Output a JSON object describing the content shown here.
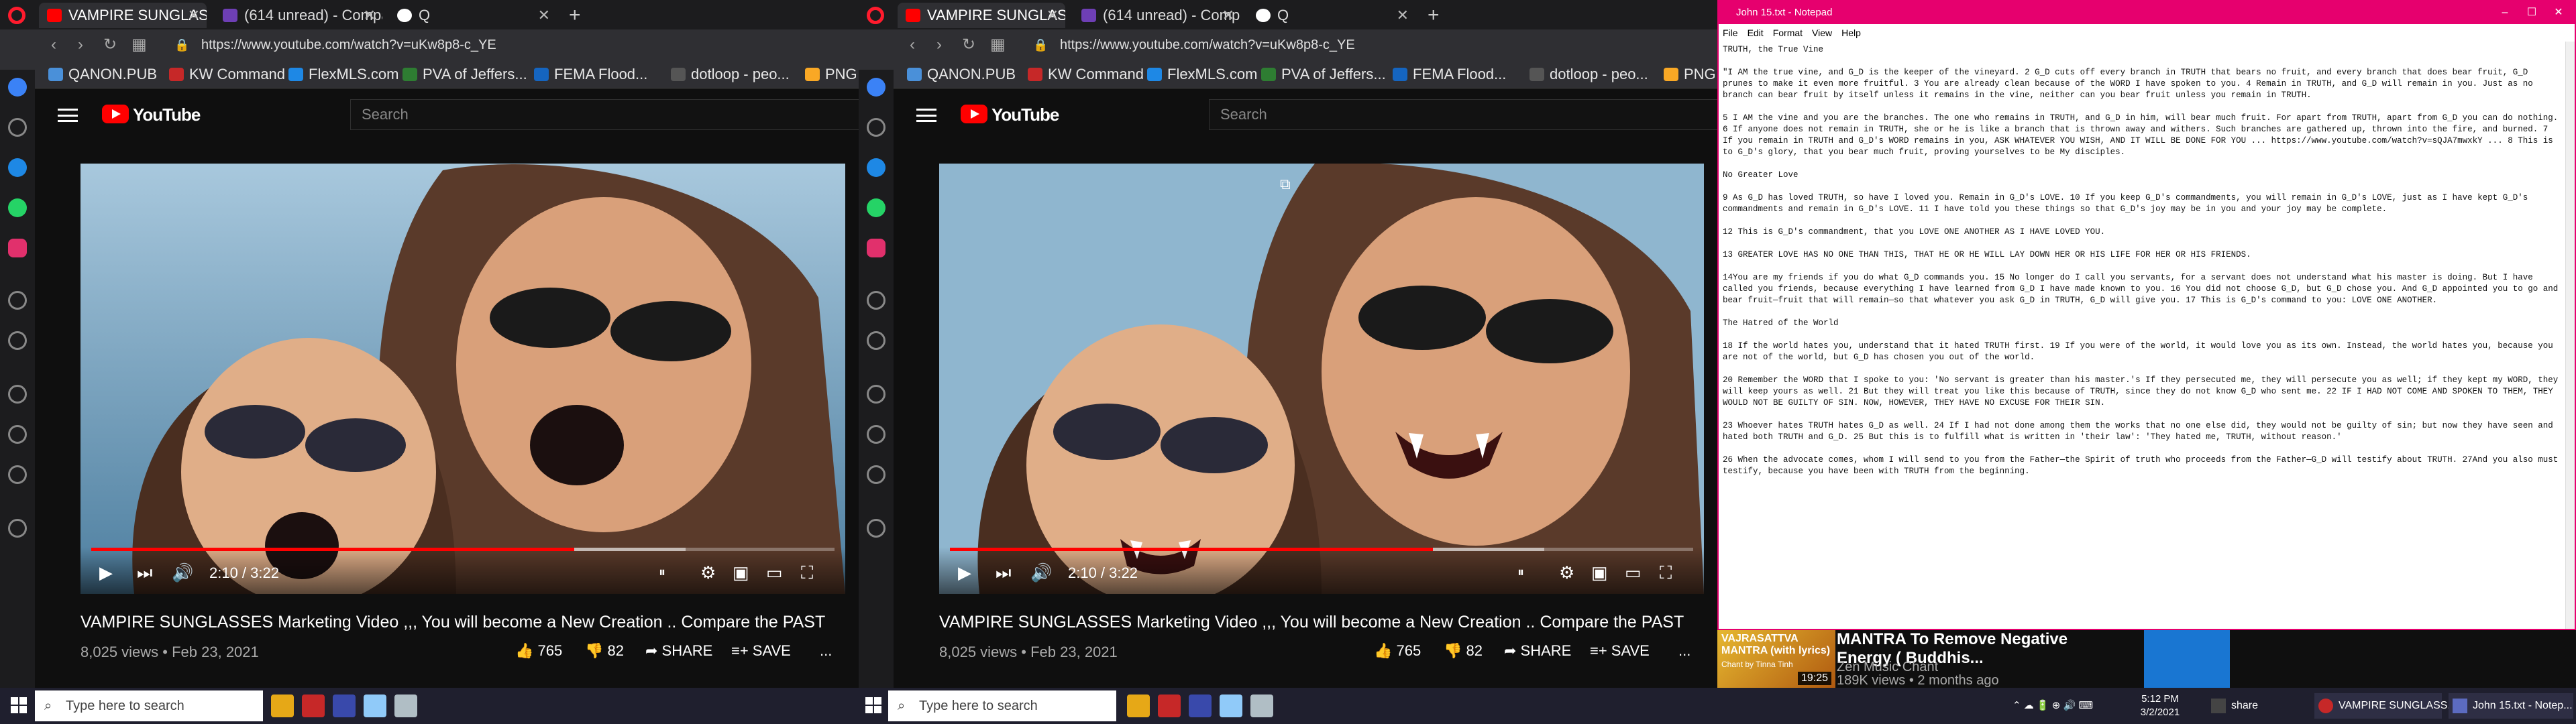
{
  "browser": {
    "tabs": [
      {
        "label": "VAMPIRE SUNGLASSES",
        "active": true,
        "favicon_color": "#ff0000"
      },
      {
        "label": "(614 unread) - Compa",
        "active": false,
        "favicon_color": "#6e3fb5"
      },
      {
        "label": "Q",
        "active": false,
        "favicon_color": "#ffffff"
      }
    ],
    "tabs_right": [
      {
        "label": "VAMPIRE SUNGLASSES",
        "favicon_color": "#ff0000"
      },
      {
        "label": "(614 unread) - Comp",
        "favicon_color": "#6e3fb5"
      },
      {
        "label": "Q",
        "favicon_color": "#ffffff"
      }
    ],
    "url": "https://www.youtube.com/watch?v=uKw8p8-c_YE",
    "bookmarks": [
      {
        "label": "QANON.PUB",
        "color": "#4a90d9"
      },
      {
        "label": "KW Command",
        "color": "#c62828"
      },
      {
        "label": "FlexMLS.com",
        "color": "#1e88e5"
      },
      {
        "label": "PVA of Jeffers...",
        "color": "#2e7d32"
      },
      {
        "label": "FEMA Flood...",
        "color": "#1565c0"
      },
      {
        "label": "dotloop - peo...",
        "color": "#555555"
      },
      {
        "label": "PNG",
        "color": "#f9a825"
      }
    ],
    "sidebar_icons": [
      {
        "name": "home-icon",
        "color": "#3b82f6"
      },
      {
        "name": "star-icon",
        "color": "#888888"
      },
      {
        "name": "messenger-icon",
        "color": "#1e88e5"
      },
      {
        "name": "whatsapp-icon",
        "color": "#25d366"
      },
      {
        "name": "instagram-icon",
        "color": "#e1306c"
      },
      {
        "name": "player-icon",
        "color": "#888888"
      },
      {
        "name": "send-icon",
        "color": "#888888"
      },
      {
        "name": "heart-icon",
        "color": "#888888"
      },
      {
        "name": "history-icon",
        "color": "#888888"
      },
      {
        "name": "settings-icon",
        "color": "#888888"
      },
      {
        "name": "pin-icon",
        "color": "#888888"
      }
    ]
  },
  "youtube": {
    "logo_text": "YouTube",
    "search_placeholder": "Search",
    "video": {
      "time": "2:10 / 3:22",
      "progress": 0.65,
      "title": "VAMPIRE SUNGLASSES Marketing Video ,,, You will become a New Creation .. Compare the PAST",
      "views_date": "8,025 views • Feb 23, 2021",
      "likes": "765",
      "dislikes": "82",
      "share": "SHARE",
      "save": "SAVE",
      "more": "..."
    }
  },
  "notepad": {
    "title": "John 15.txt - Notepad",
    "menu": [
      "File",
      "Edit",
      "Format",
      "View",
      "Help"
    ],
    "text": "TRUTH, the True Vine\n\n\"I AM the true vine, and G_D is the keeper of the vineyard. 2 G_D cuts off every branch in TRUTH that bears no fruit, and every branch that does bear fruit, G_D prunes to make it even more fruitful. 3 You are already clean because of the WORD I have spoken to you. 4 Remain in TRUTH, and G_D will remain in you. Just as no branch can bear fruit by itself unless it remains in the vine, neither can you bear fruit unless you remain in TRUTH.\n\n5 I AM the vine and you are the branches. The one who remains in TRUTH, and G_D in him, will bear much fruit. For apart from TRUTH, apart from G_D you can do nothing. 6 If anyone does not remain in TRUTH, she or he is like a branch that is thrown away and withers. Such branches are gathered up, thrown into the fire, and burned. 7 If you remain in TRUTH and G_D's WORD remains in you, ASK WHATEVER YOU WISH, AND IT WILL BE DONE FOR YOU ... https://www.youtube.com/watch?v=sQJA7mwxkY ... 8 This is to G_D's glory, that you bear much fruit, proving yourselves to be My disciples.\n\nNo Greater Love\n\n9 As G_D has loved TRUTH, so have I loved you. Remain in G_D's LOVE. 10 If you keep G_D's commandments, you will remain in G_D's LOVE, just as I have kept G_D's commandments and remain in G_D's LOVE. 11 I have told you these things so that G_D's joy may be in you and your joy may be complete.\n\n12 This is G_D's commandment, that you LOVE ONE ANOTHER AS I HAVE LOVED YOU.\n\n13 GREATER LOVE HAS NO ONE THAN THIS, THAT HE OR HE WILL LAY DOWN HER OR HIS LIFE FOR HER OR HIS FRIENDS.\n\n14You are my friends if you do what G_D commands you. 15 No longer do I call you servants, for a servant does not understand what his master is doing. But I have called you friends, because everything I have learned from G_D I have made known to you. 16 You did not choose G_D, but G_D chose you. And G_D appointed you to go and bear fruit—fruit that will remain—so that whatever you ask G_D in TRUTH, G_D will give you. 17 This is G_D's command to you: LOVE ONE ANOTHER.\n\nThe Hatred of the World\n\n18 If the world hates you, understand that it hated TRUTH first. 19 If you were of the world, it would love you as its own. Instead, the world hates you, because you are not of the world, but G_D has chosen you out of the world.\n\n20 Remember the WORD that I spoke to you: 'No servant is greater than his master.'s If they persecuted me, they will persecute you as well; if they kept my WORD, they will keep yours as well. 21 But they will treat you like this because of TRUTH, since they do not know G_D who sent me. 22 IF I HAD NOT COME AND SPOKEN TO THEM, THEY WOULD NOT BE GUILTY OF SIN. NOW, HOWEVER, THEY HAVE NO EXCUSE FOR THEIR SIN.\n\n23 Whoever hates TRUTH hates G_D as well. 24 If I had not done among them the works that no one else did, they would not be guilty of sin; but now they have seen and hated both TRUTH and G_D. 25 But this is to fulfill what is written in 'their law': 'They hated me, TRUTH, without reason.'\n\n26 When the advocate comes, whom I will send to you from the Father—the Spirit of truth who proceeds from the Father—G_D will testify about TRUTH. 27And you also must testify, because you have been with TRUTH from the beginning."
  },
  "recommendation": {
    "thumb_text": "VAJRASATTVA MANTRA (with lyrics)",
    "thumb_sub": "Chant by Tinna Tinh",
    "duration": "19:25",
    "title": "MANTRA To Remove Negative Energy ( Buddhis...",
    "channel": "Zen Music Chant",
    "meta": "189K views • 2 months ago"
  },
  "taskbar": {
    "search_placeholder": "Type here to search",
    "items": [
      {
        "label": "",
        "color": "#e6a817"
      },
      {
        "label": "",
        "color": "#c62828"
      },
      {
        "label": "",
        "color": "#3949ab"
      },
      {
        "label": "",
        "color": "#90caf9"
      },
      {
        "label": "",
        "color": "#b0bec5"
      }
    ],
    "right_items": [
      {
        "label": "share",
        "color": "#444444"
      },
      {
        "label": "VAMPIRE SUNGLASS...",
        "color": "#c62828"
      },
      {
        "label": "John 15.txt - Notep...",
        "color": "#5c6bc0"
      }
    ],
    "clock_time": "5:12 PM",
    "clock_date": "3/2/2021"
  }
}
